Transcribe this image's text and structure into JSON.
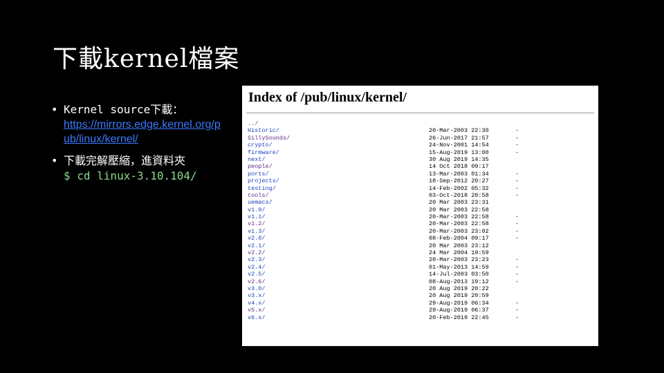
{
  "slide": {
    "title": "下載kernel檔案",
    "bullets": [
      {
        "text": "Kernel source下載：",
        "link": "https://mirrors.edge.kernel.org/pub/linux/kernel/"
      },
      {
        "text": "下載完解壓縮，進資料夾",
        "command": "$ cd linux-3.10.104/"
      }
    ],
    "bullet_glyph": "•"
  },
  "listing": {
    "title": "Index of /pub/linux/kernel/",
    "entries": [
      {
        "name": "../",
        "date": "",
        "size": ""
      },
      {
        "name": "Historic/",
        "date": "20-Mar-2003 22:30",
        "size": "-"
      },
      {
        "name": "SillySounds/",
        "date": "26-Jun-2017 21:57",
        "size": "-"
      },
      {
        "name": "crypto/",
        "date": "24-Nov-2001 14:54",
        "size": "-"
      },
      {
        "name": "firmware/",
        "date": "15-Aug-2019 13:00",
        "size": "-"
      },
      {
        "name": "next/",
        "date": "30 Aug 2019 14:35",
        "size": ""
      },
      {
        "name": "people/",
        "date": "14 Oct 2018 09:17",
        "size": ""
      },
      {
        "name": "ports/",
        "date": "13-Mar-2003 01:34",
        "size": "-"
      },
      {
        "name": "projects/",
        "date": "18-Sep-2012 20:27",
        "size": "-"
      },
      {
        "name": "testing/",
        "date": "14-Feb-2002 05:32",
        "size": "-"
      },
      {
        "name": "tools/",
        "date": "03-Oct-2018 20:58",
        "size": "-"
      },
      {
        "name": "uemacs/",
        "date": "20 Mar 2003 23:31",
        "size": ""
      },
      {
        "name": "v1.0/",
        "date": "20 Mar 2003 22:58",
        "size": ""
      },
      {
        "name": "v1.1/",
        "date": "20-Mar-2003 22:58",
        "size": "-"
      },
      {
        "name": "v1.2/",
        "date": "20-Mar-2003 22:58",
        "size": "-"
      },
      {
        "name": "v1.3/",
        "date": "20-Mar-2003 23:02",
        "size": "-"
      },
      {
        "name": "v2.0/",
        "date": "08-Feb-2004 09:17",
        "size": "-"
      },
      {
        "name": "v2.1/",
        "date": "20 Mar 2003 23:12",
        "size": ""
      },
      {
        "name": "v2.2/",
        "date": "24 Mar 2004 19:59",
        "size": ""
      },
      {
        "name": "v2.3/",
        "date": "20-Mar-2003 23:23",
        "size": "-"
      },
      {
        "name": "v2.4/",
        "date": "01-May-2013 14:59",
        "size": "-"
      },
      {
        "name": "v2.5/",
        "date": "14-Jul-2003 03:50",
        "size": "-"
      },
      {
        "name": "v2.6/",
        "date": "08-Aug-2013 19:12",
        "size": "-"
      },
      {
        "name": "v3.0/",
        "date": "20 Aug 2019 20:22",
        "size": ""
      },
      {
        "name": "v3.x/",
        "date": "20 Aug 2019 20:59",
        "size": ""
      },
      {
        "name": "v4.x/",
        "date": "29-Aug-2019 06:34",
        "size": "-"
      },
      {
        "name": "v5.x/",
        "date": "29-Aug-2019 06:37",
        "size": "-"
      },
      {
        "name": "v6.x/",
        "date": "20-Feb-2019 22:45",
        "size": "-"
      }
    ]
  },
  "colors": {
    "background": "#000000",
    "link": "#3b7bff",
    "command": "#8bd88b",
    "listing_link": "#1a3fbd",
    "listing_visited": "#5d2a8a"
  }
}
